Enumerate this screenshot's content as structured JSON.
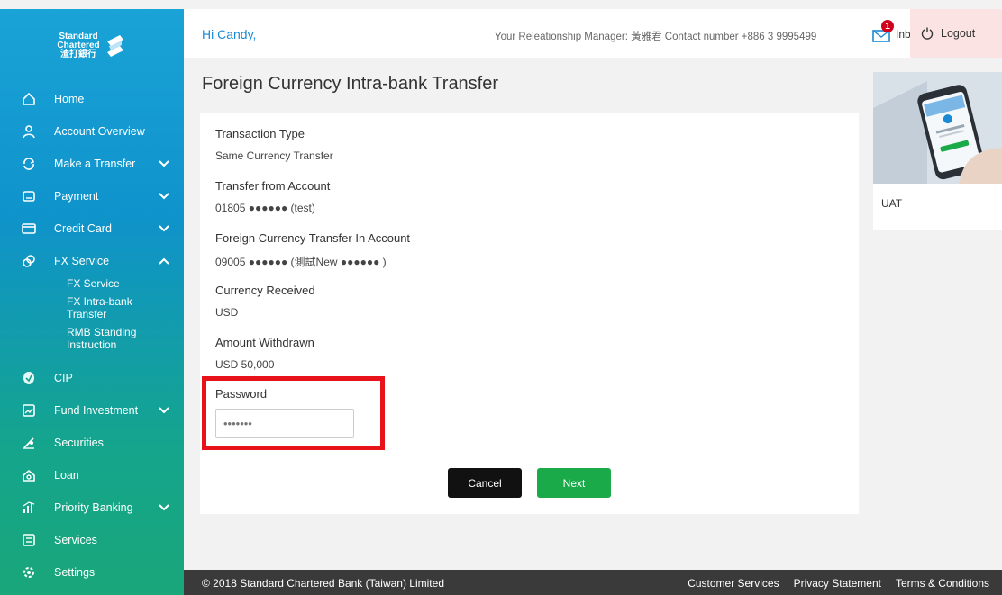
{
  "brand": {
    "name_lines": [
      "Standard",
      "Chartered",
      "渣打銀行"
    ]
  },
  "sidebar": {
    "items": [
      {
        "label": "Home",
        "icon": "home-icon"
      },
      {
        "label": "Account Overview",
        "icon": "user-icon"
      },
      {
        "label": "Make a Transfer",
        "icon": "transfer-icon",
        "chevron": "down"
      },
      {
        "label": "Payment",
        "icon": "payment-icon",
        "chevron": "down"
      },
      {
        "label": "Credit Card",
        "icon": "credit-card-icon",
        "chevron": "down"
      },
      {
        "label": "FX Service",
        "icon": "fx-icon",
        "chevron": "up"
      },
      {
        "label": "CIP",
        "icon": "cip-icon"
      },
      {
        "label": "Fund Investment",
        "icon": "fund-icon",
        "chevron": "down"
      },
      {
        "label": "Securities",
        "icon": "securities-icon"
      },
      {
        "label": "Loan",
        "icon": "loan-icon"
      },
      {
        "label": "Priority Banking",
        "icon": "priority-icon",
        "chevron": "down"
      },
      {
        "label": "Services",
        "icon": "services-icon"
      },
      {
        "label": "Settings",
        "icon": "settings-icon"
      }
    ],
    "fx_sub": [
      "FX Service",
      "FX Intra-bank Transfer",
      "RMB Standing Instruction"
    ]
  },
  "header": {
    "greeting": "Hi Candy,",
    "relationship_manager": "Your Releationship Manager: 黃雅君 Contact number +886 3 9995499",
    "inbox_label": "Inbox",
    "inbox_count": "1",
    "logout_label": "Logout"
  },
  "main": {
    "title": "Foreign Currency Intra-bank Transfer",
    "fields": [
      {
        "label": "Transaction Type",
        "value": "Same Currency Transfer"
      },
      {
        "label": "Transfer from Account",
        "value": "01805 ●●●●●● (test)"
      },
      {
        "label": "Foreign Currency Transfer In Account",
        "value": "09005 ●●●●●● (測試New ●●●●●● )"
      },
      {
        "label": "Currency Received",
        "value": "USD"
      },
      {
        "label": "Amount Withdrawn",
        "value": "USD 50,000"
      }
    ],
    "password": {
      "label": "Password",
      "value": "•••••••"
    },
    "cancel_label": "Cancel",
    "next_label": "Next"
  },
  "promo": {
    "label": "UAT"
  },
  "footer": {
    "copyright": "© 2018 Standard Chartered Bank (Taiwan) Limited",
    "links": [
      "Customer Services",
      "Privacy Statement",
      "Terms & Conditions"
    ]
  },
  "colors": {
    "accent_blue": "#1a8ad4",
    "next_green": "#1aaa4a",
    "highlight_red": "#e8121b",
    "sidebar_top": "#1aa3d6",
    "sidebar_bottom": "#1aa67a"
  }
}
